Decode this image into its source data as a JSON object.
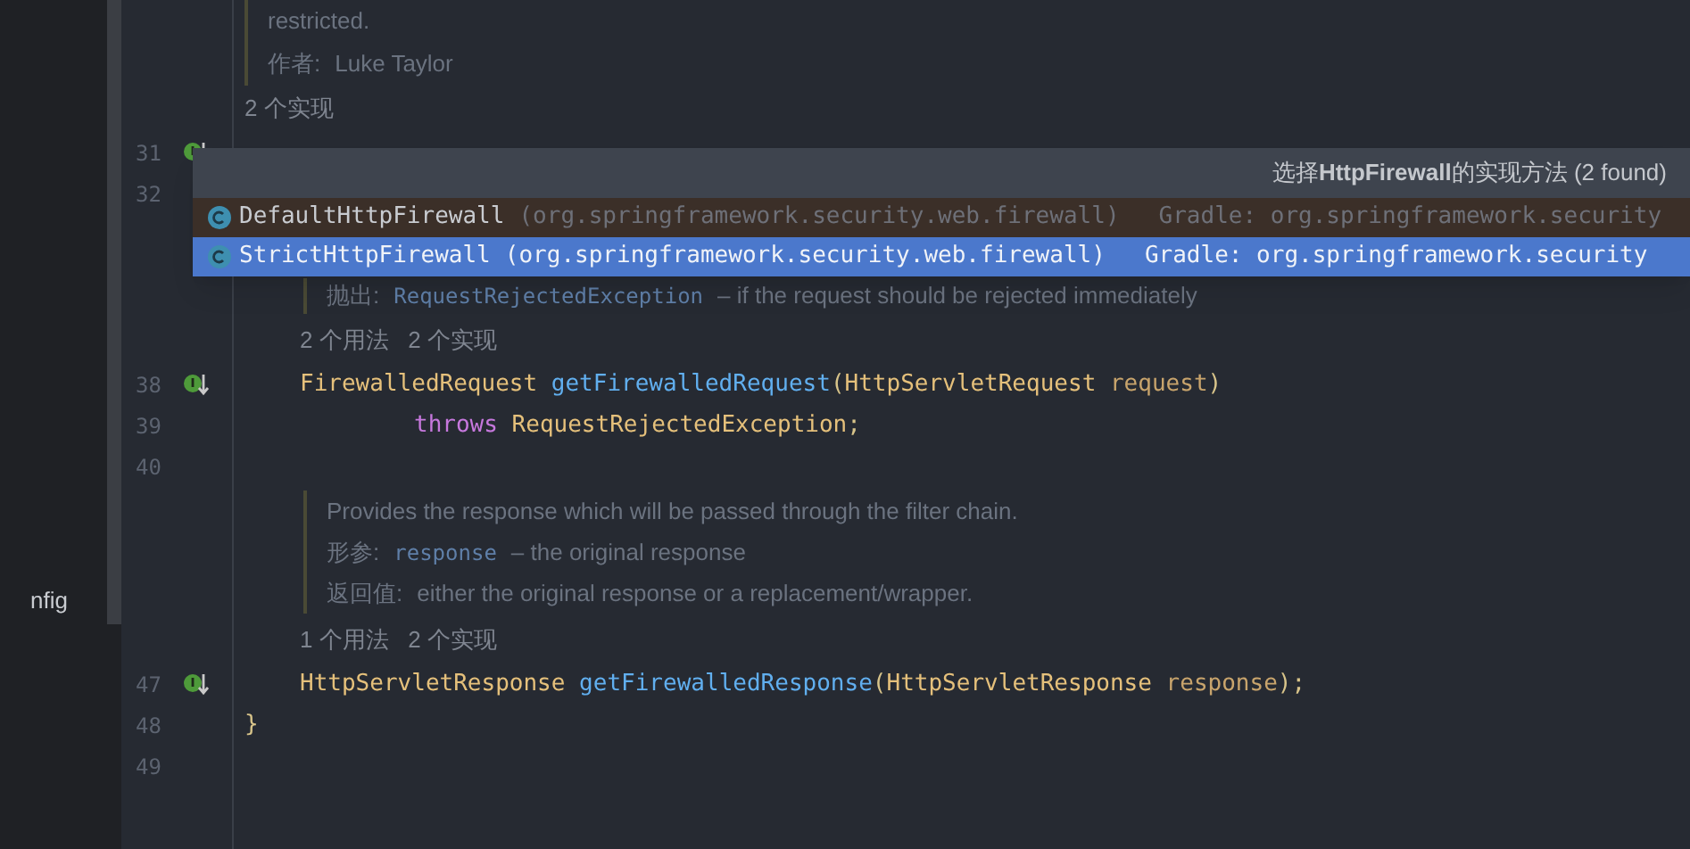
{
  "sidebar": {
    "items": [
      {
        "label": "nfig"
      }
    ]
  },
  "editor": {
    "lines": [
      {
        "kind": "doc",
        "entries": [
          {
            "text": "restricted."
          },
          {
            "label": "作者:",
            "text": "Luke Taylor"
          }
        ]
      },
      {
        "kind": "type_hint",
        "text": "2 个实现"
      },
      {
        "kind": "member",
        "number": "31",
        "marker": true
      },
      {
        "kind": "member",
        "number": "32",
        "marker": false
      },
      {
        "kind": "doc_nested",
        "entries": [
          {
            "label": "抛出:",
            "code": "RequestRejectedException",
            "text": "– if the request should be rejected immediately"
          }
        ]
      },
      {
        "kind": "member_hint",
        "text": "2 个用法   2 个实现"
      },
      {
        "kind": "member",
        "number": "38",
        "marker": true,
        "tokens": [
          {
            "color": "#e5c07b",
            "text": "FirewalledRequest"
          },
          {
            "color": "#61afef",
            "text": "getFirewalledRequest"
          },
          {
            "color": "#d8c48a",
            "text": "("
          },
          {
            "color": "#e5c07b",
            "text": "HttpServletRequest"
          },
          {
            "color": "#c8a46c",
            "text": "request"
          },
          {
            "color": "#d8c48a",
            "text": ")"
          }
        ]
      },
      {
        "kind": "continuation",
        "number": "39",
        "marker": false,
        "tokens": [
          {
            "color": "#c678dd",
            "text": "throws"
          },
          {
            "color": "#e5c07b",
            "text": "RequestRejectedException"
          },
          {
            "color": "#d8c48a",
            "text": ";"
          }
        ]
      },
      {
        "kind": "member",
        "number": "40",
        "marker": false
      },
      {
        "kind": "doc_nested",
        "entries": [
          {
            "text": "Provides the response which will be passed through the filter chain."
          },
          {
            "label": "形参:",
            "code": "response",
            "text": "– the original response"
          },
          {
            "label": "返回值:",
            "text": "either the original response or a replacement/wrapper."
          }
        ]
      },
      {
        "kind": "member_hint",
        "text": "1 个用法   2 个实现"
      },
      {
        "kind": "member",
        "number": "47",
        "marker": true,
        "tokens": [
          {
            "color": "#e5c07b",
            "text": "HttpServletResponse"
          },
          {
            "color": "#61afef",
            "text": "getFirewalledResponse"
          },
          {
            "color": "#d8c48a",
            "text": "("
          },
          {
            "color": "#e5c07b",
            "text": "HttpServletResponse"
          },
          {
            "color": "#c8a46c",
            "text": "response"
          },
          {
            "color": "#d8c48a",
            "text": ");"
          }
        ]
      },
      {
        "kind": "top",
        "number": "48",
        "marker": false,
        "tokens": [
          {
            "color": "#d8c48a",
            "text": "}"
          }
        ]
      },
      {
        "kind": "top",
        "number": "49",
        "marker": false
      }
    ]
  },
  "popup": {
    "title": "选择**HttpFirewall**的实现方法 (2 found)",
    "items": [
      {
        "name": "DefaultHttpFirewall",
        "package": "(org.springframework.security.web.firewall)",
        "source": "Gradle: org.springframework.security",
        "selected": false
      },
      {
        "name": "StrictHttpFirewall",
        "package": "(org.springframework.security.web.firewall)",
        "source": "Gradle: org.springframework.security",
        "selected": true
      }
    ]
  }
}
